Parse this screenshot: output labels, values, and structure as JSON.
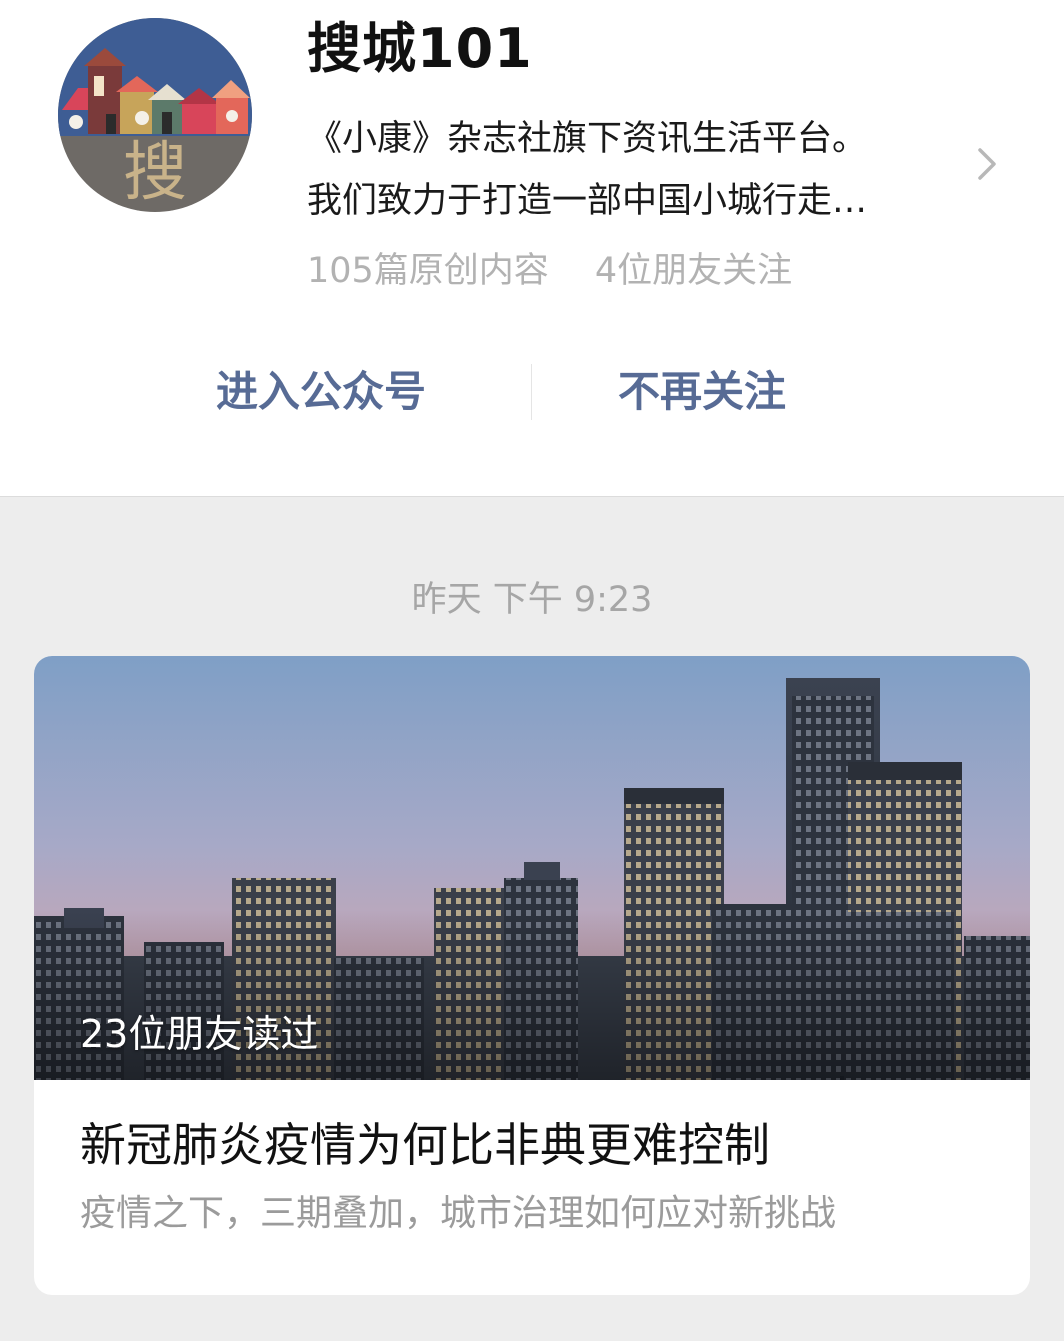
{
  "account": {
    "name": "搜城101",
    "avatar_char": "搜",
    "description_lines": [
      "《小康》杂志社旗下资讯生活平台。",
      "我们致力于打造一部中国小城行走…"
    ],
    "original_count": "105篇原创内容",
    "friends_following": "4位朋友关注"
  },
  "actions": {
    "enter": "进入公众号",
    "unfollow": "不再关注"
  },
  "feed": {
    "timestamp": "昨天 下午 9:23",
    "article": {
      "read_by_friends": "23位朋友读过",
      "title": "新冠肺炎疫情为何比非典更难控制",
      "subtitle": "疫情之下，三期叠加，城市治理如何应对新挑战"
    }
  },
  "colors": {
    "link": "#576b95",
    "page_background": "#ededed",
    "secondary_text": "#b2b2b2"
  },
  "icons": {
    "detail": "chevron-right-icon"
  }
}
